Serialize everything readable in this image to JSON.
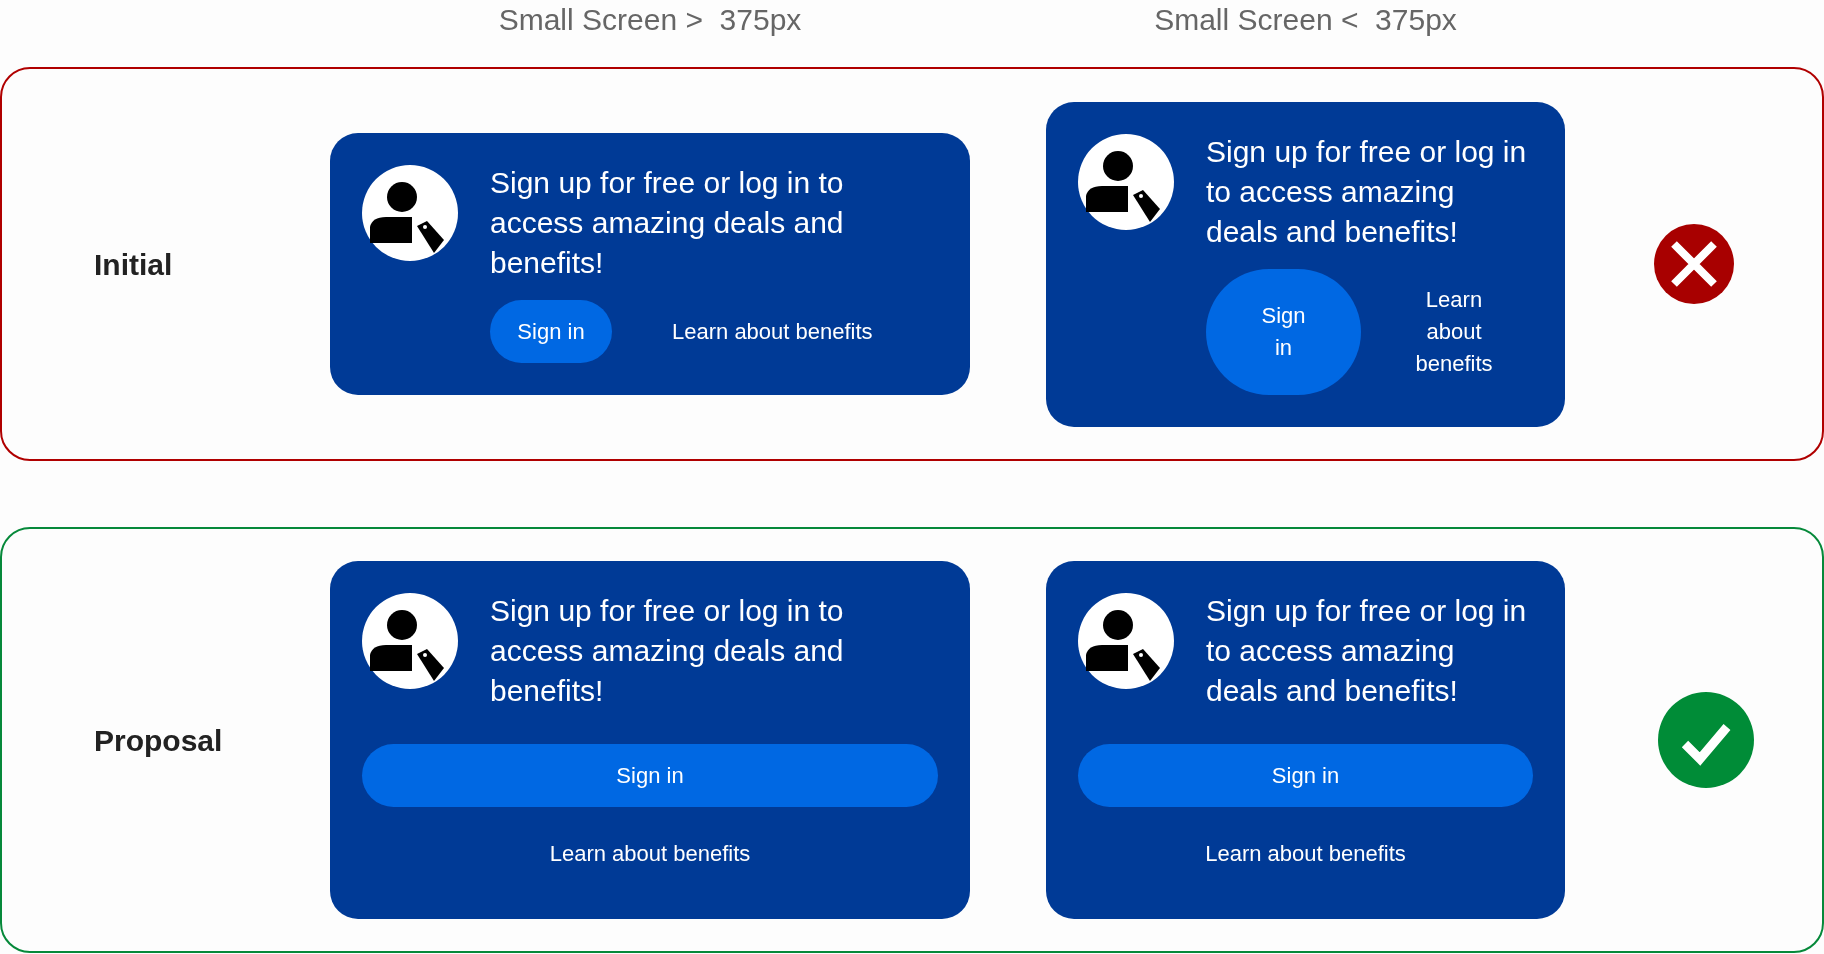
{
  "columns": [
    "Small Screen >  375px",
    "Small Screen <  375px"
  ],
  "rows": [
    {
      "label": "Initial",
      "kind": "reject",
      "cards": [
        {
          "kind": "inline",
          "message": "Sign up for free or log in to access amazing deals and benefits!",
          "sign_in": "Sign in",
          "learn": "Learn about benefits"
        },
        {
          "kind": "inline",
          "message": "Sign up for free or log in to access amazing deals and benefits!",
          "sign_in": "Sign in",
          "learn": "Learn about benefits"
        }
      ]
    },
    {
      "label": "Proposal",
      "kind": "accept",
      "cards": [
        {
          "kind": "stacked",
          "message": "Sign up for free or log in to access amazing deals and benefits!",
          "sign_in": "Sign in",
          "learn": "Learn about benefits"
        },
        {
          "kind": "stacked",
          "message": "Sign up for free or log in to access amazing deals and benefits!",
          "sign_in": "Sign in",
          "learn": "Learn about benefits"
        }
      ]
    }
  ]
}
